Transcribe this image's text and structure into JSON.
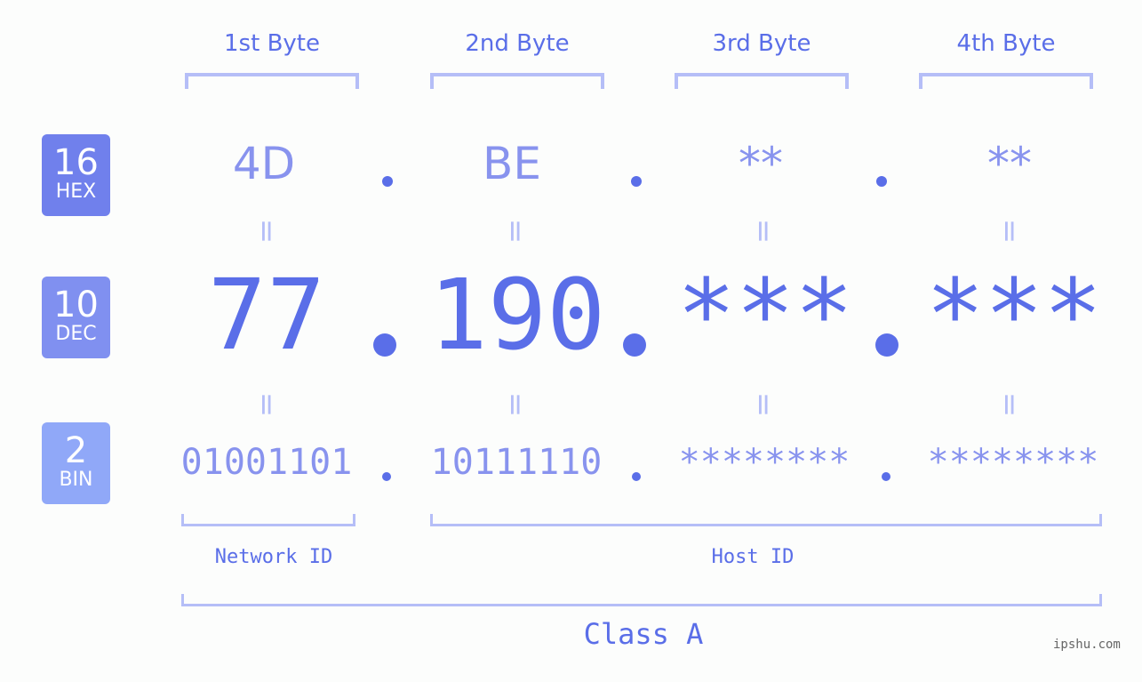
{
  "bytes": [
    {
      "header": "1st Byte",
      "hex": "4D",
      "dec": "77",
      "bin": "01001101"
    },
    {
      "header": "2nd Byte",
      "hex": "BE",
      "dec": "190",
      "bin": "10111110"
    },
    {
      "header": "3rd Byte",
      "hex": "**",
      "dec": "***",
      "bin": "********"
    },
    {
      "header": "4th Byte",
      "hex": "**",
      "dec": "***",
      "bin": "********"
    }
  ],
  "badges": {
    "hex": {
      "num": "16",
      "label": "HEX",
      "color": "#7080ec"
    },
    "dec": {
      "num": "10",
      "label": "DEC",
      "color": "#8090f0"
    },
    "bin": {
      "num": "2",
      "label": "BIN",
      "color": "#90a8f8"
    }
  },
  "equals": "=",
  "separator": ".",
  "labels": {
    "network": "Network ID",
    "host": "Host ID",
    "class": "Class A"
  },
  "watermark": "ipshu.com"
}
